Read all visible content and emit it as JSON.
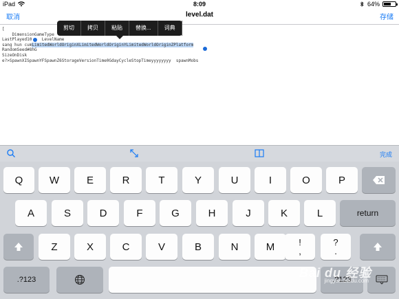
{
  "status_bar": {
    "device": "iPad",
    "time": "8:09",
    "battery": "64%",
    "battery_level": 0.64
  },
  "nav": {
    "cancel": "取消",
    "title": "level.dat",
    "save": "存储"
  },
  "editor": {
    "lines": {
      "l1": "[",
      "l2": "    DimensionGameType  GeneratorN",
      "l3": "LastPlayed10    LevelName",
      "l4a": "sang hun cum",
      "l4sel": "LimitedWorldOriginXLimitedWorldOriginYLimitedWorldOriginZPlatform",
      "l5": "RandomSeed#8hG",
      "l6": "SizeOnDisk",
      "l7": "e?>SpawnXISpawnYFSpawnZ6StorageVersionTime0GdayCycleStopTimeyyyyyyyy  spawnMobs"
    }
  },
  "edit_menu": [
    "剪切",
    "拷贝",
    "粘贴",
    "替换...",
    "词典"
  ],
  "shortcut_bar": {
    "search_icon": "search-icon",
    "resize_icon": "expand-arrows-icon",
    "book_icon": "book-icon",
    "done": "完成"
  },
  "keyboard": {
    "row1": [
      "Q",
      "W",
      "E",
      "R",
      "T",
      "Y",
      "U",
      "I",
      "O",
      "P"
    ],
    "row2": [
      "A",
      "S",
      "D",
      "F",
      "G",
      "H",
      "J",
      "K",
      "L"
    ],
    "row3": [
      "Z",
      "X",
      "C",
      "V",
      "B",
      "N",
      "M"
    ],
    "return": "return",
    "punct1_top": "!",
    "punct1_bottom": ",",
    "punct2_top": "?",
    "punct2_bottom": ".",
    "numbers_left": ".?123",
    "numbers_right": ".?123"
  },
  "watermark": {
    "brand": "Bai du 经验",
    "url": "jingyan.baidu.com"
  }
}
